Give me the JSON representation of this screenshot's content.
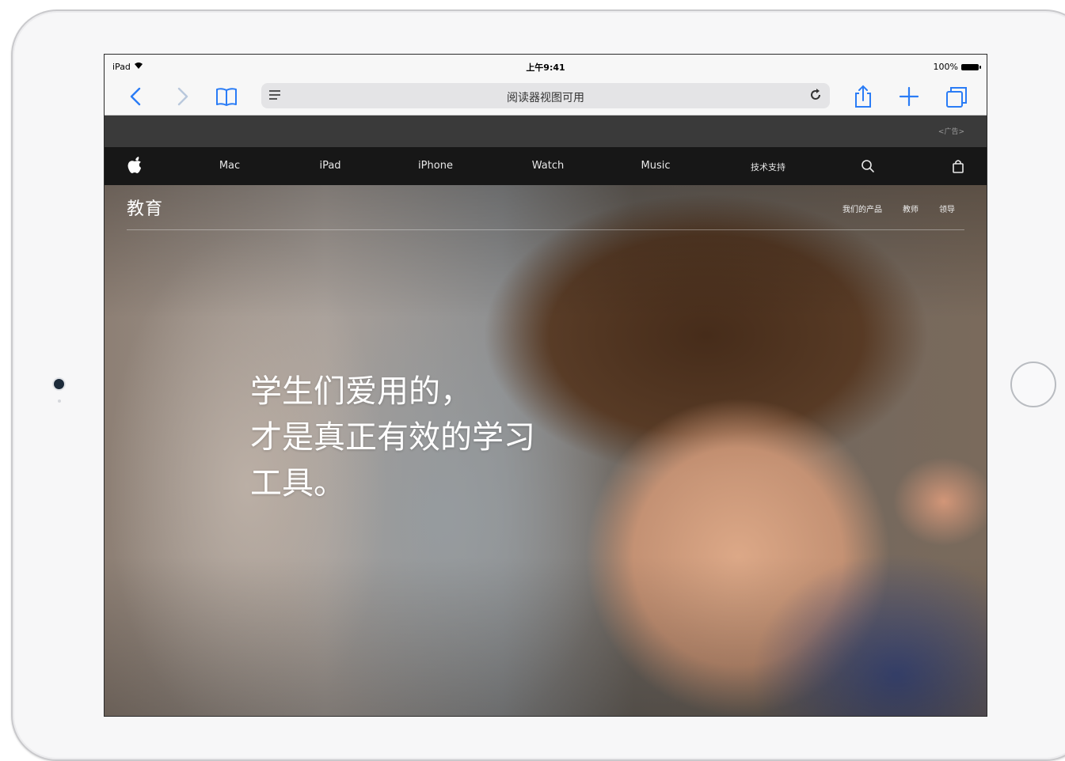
{
  "status_bar": {
    "device": "iPad",
    "time": "上午9:41",
    "battery": "100%"
  },
  "safari": {
    "address_text": "阅读器视图可用"
  },
  "ad": {
    "label": "<广告>"
  },
  "globalnav": {
    "items": [
      "Mac",
      "iPad",
      "iPhone",
      "Watch",
      "Music",
      "技术支持"
    ]
  },
  "localnav": {
    "title": "教育",
    "links": [
      "我们的产品",
      "教师",
      "领导"
    ]
  },
  "hero": {
    "headline_lines": [
      "学生们爱用的，",
      "才是真正有效的学习",
      "工具。"
    ]
  },
  "icons": {
    "back": "chevron-left-icon",
    "forward": "chevron-right-icon",
    "bookmarks": "book-icon",
    "reader": "reader-icon",
    "reload": "reload-icon",
    "share": "share-icon",
    "new_tab": "plus-icon",
    "tabs": "tabs-icon",
    "apple": "apple-logo",
    "search": "search-icon",
    "bag": "bag-icon"
  },
  "colors": {
    "accent": "#2a7cf6",
    "nav_bg": "#171717",
    "ad_bg": "#3a3a3a"
  }
}
